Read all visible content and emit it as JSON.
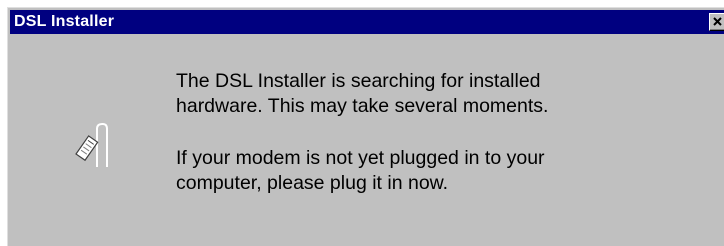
{
  "window": {
    "title": "DSL Installer",
    "close_icon": "close-icon"
  },
  "message": {
    "icon": "plug-icon",
    "line1": "The DSL Installer is searching for installed",
    "line2": "hardware.  This may take several moments.",
    "line3": "If your modem is not yet plugged in to your",
    "line4": "computer, please plug it in now."
  },
  "colors": {
    "titlebar": "#000080",
    "window_face": "#c0c0c0",
    "title_text": "#ffffff"
  }
}
